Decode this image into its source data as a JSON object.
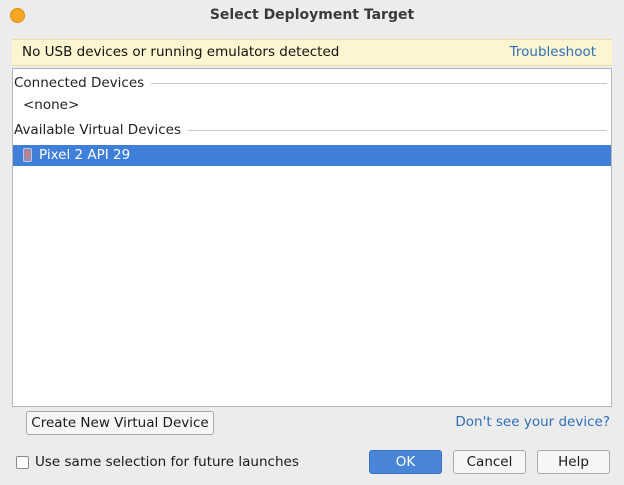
{
  "window": {
    "title": "Select Deployment Target"
  },
  "banner": {
    "message": "No USB devices or running emulators detected",
    "link": "Troubleshoot"
  },
  "device_list": {
    "connected_header": "Connected Devices",
    "connected_none": "<none>",
    "virtual_header": "Available Virtual Devices",
    "virtual_devices": [
      {
        "name": "Pixel 2 API 29",
        "icon": "phone-icon",
        "selected": true
      }
    ]
  },
  "actions": {
    "create_label": "Create New Virtual Device",
    "dont_see_link": "Don't see your device?",
    "checkbox_label": "Use same selection for future launches",
    "checkbox_checked": false,
    "ok_label": "OK",
    "cancel_label": "Cancel",
    "help_label": "Help"
  },
  "colors": {
    "selection": "#3f7fd9",
    "banner_bg": "#fdf5cf",
    "link": "#2f6fb8",
    "primary_button": "#4a86d8",
    "window_dot": "#f5a623"
  }
}
